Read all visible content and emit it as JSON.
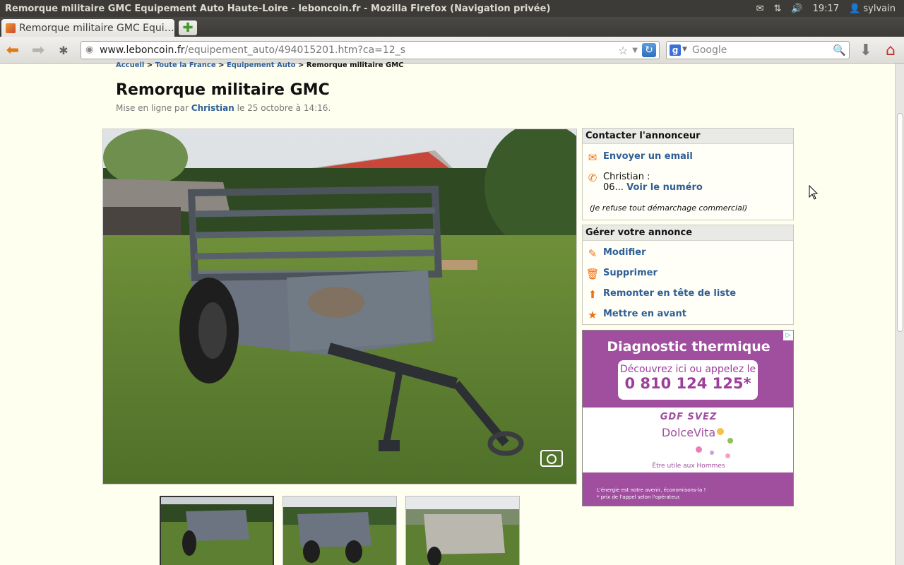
{
  "os": {
    "window_title": "Remorque militaire GMC Equipement Auto Haute-Loire - leboncoin.fr - Mozilla Firefox (Navigation privée)",
    "time": "19:17",
    "user": "sylvain"
  },
  "browser": {
    "tab_title": "Remorque militaire GMC Equi…",
    "url_host": "www.leboncoin.fr",
    "url_path": "/equipement_auto/494015201.htm?ca=12_s",
    "search_placeholder": "Google"
  },
  "breadcrumb": {
    "items": [
      "Accueil",
      "Toute la France",
      "Equipement Auto"
    ],
    "current": "Remorque militaire GMC",
    "separator": ">"
  },
  "listing": {
    "title": "Remorque militaire GMC",
    "posted_prefix": "Mise en ligne par",
    "author": "Christian",
    "posted_suffix": "le 25 octobre à 14:16."
  },
  "contact": {
    "heading": "Contacter l'annonceur",
    "email_label": "Envoyer un email",
    "name_line": "Christian :",
    "phone_prefix": "06...",
    "phone_link": "Voir le numéro",
    "disclaimer": "(Je refuse tout démarchage commercial)"
  },
  "manage": {
    "heading": "Gérer votre annonce",
    "items": [
      {
        "label": "Modifier",
        "icon": "pencil-icon"
      },
      {
        "label": "Supprimer",
        "icon": "trash-icon"
      },
      {
        "label": "Remonter en tête de liste",
        "icon": "arrow-up-icon"
      },
      {
        "label": "Mettre en avant",
        "icon": "star-icon"
      }
    ]
  },
  "ad": {
    "title": "Diagnostic thermique",
    "line1": "Découvrez ici ou appelez le",
    "phone": "0 810 124 125*",
    "brand": "GDF SVEZ",
    "product": "DolceVita",
    "tagline": "Être utile aux Hommes",
    "footer1": "L'énergie est notre avenir, économisons-la !",
    "footer2": "* prix de l'appel selon l'opérateur."
  },
  "colors": {
    "link": "#2f5f96",
    "accent_orange": "#e7731c",
    "ad_purple": "#a04f9f",
    "page_bg": "#fffff0"
  }
}
